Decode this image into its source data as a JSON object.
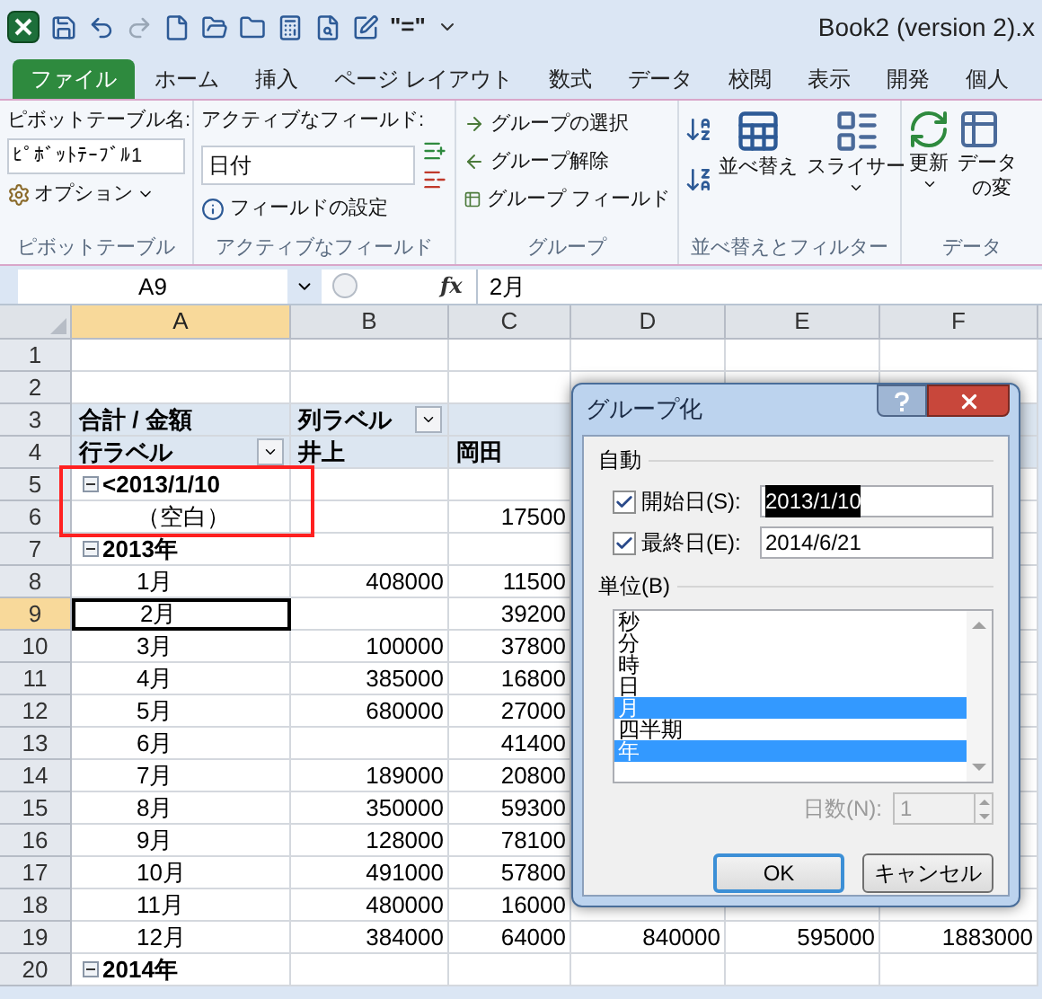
{
  "window": {
    "title": "Book2 (version 2).x",
    "quick_access_label": "\"=\""
  },
  "file_tab": "ファイル",
  "tabs": [
    {
      "label": "ホーム",
      "selected": false
    },
    {
      "label": "挿入",
      "selected": false
    },
    {
      "label": "ページ レイアウト",
      "selected": false
    },
    {
      "label": "数式",
      "selected": false
    },
    {
      "label": "データ",
      "selected": false
    },
    {
      "label": "校閲",
      "selected": false
    },
    {
      "label": "表示",
      "selected": false
    },
    {
      "label": "開発",
      "selected": false
    },
    {
      "label": "個人",
      "selected": false
    }
  ],
  "ribbon": {
    "pivot_group": {
      "title": "ピボットテーブル",
      "name_label": "ピボットテーブル名:",
      "name_value": "ﾋﾟﾎﾞｯﾄﾃｰﾌﾞﾙ1",
      "options": "オプション"
    },
    "field_group": {
      "title": "アクティブなフィールド",
      "label": "アクティブなフィールド:",
      "value": "日付",
      "settings": "フィールドの設定"
    },
    "group_group": {
      "title": "グループ",
      "items": [
        "グループの選択",
        "グループ解除",
        "グループ フィールド"
      ]
    },
    "sort_group": {
      "title": "並べ替えとフィルター",
      "sort": "並べ替え",
      "slicer": "スライサー"
    },
    "data_group": {
      "title": "データ",
      "refresh": "更新",
      "change": [
        "データ",
        "の変"
      ]
    }
  },
  "name_box": "A9",
  "function_label": "fx",
  "formula": "2月",
  "columns": [
    {
      "label": "A",
      "selected": true
    },
    {
      "label": "B",
      "selected": false
    },
    {
      "label": "C",
      "selected": false
    },
    {
      "label": "D",
      "selected": false
    },
    {
      "label": "E",
      "selected": false
    },
    {
      "label": "F",
      "selected": false
    }
  ],
  "rows": [
    {
      "number": "1",
      "kind": "plain",
      "selected": false,
      "boxed": false,
      "cells": {}
    },
    {
      "number": "2",
      "kind": "plain",
      "selected": false,
      "boxed": false,
      "cells": {}
    },
    {
      "number": "3",
      "kind": "pivot_header",
      "selected": false,
      "boxed": false,
      "cells": {
        "A": "合計 / 金額",
        "B": {
          "text": "列ラベル",
          "filter": true
        }
      }
    },
    {
      "number": "4",
      "kind": "pivot_header",
      "selected": false,
      "boxed": false,
      "cells": {
        "A": {
          "text": "行ラベル",
          "filter": true
        },
        "B": "井上",
        "C": "岡田"
      }
    },
    {
      "number": "5",
      "kind": "group",
      "expanded": true,
      "selected": false,
      "boxed": true,
      "cells": {
        "A": "<2013/1/10"
      }
    },
    {
      "number": "6",
      "kind": "item",
      "selected": false,
      "boxed": true,
      "cells": {
        "A": "（空白）",
        "C": "17500"
      }
    },
    {
      "number": "7",
      "kind": "group",
      "expanded": true,
      "selected": false,
      "boxed": false,
      "cells": {
        "A": "2013年"
      }
    },
    {
      "number": "8",
      "kind": "item",
      "selected": false,
      "boxed": false,
      "cells": {
        "A": "1月",
        "B": "408000",
        "C": "11500"
      }
    },
    {
      "number": "9",
      "kind": "item",
      "selected": true,
      "boxed": false,
      "cells": {
        "A": "2月",
        "C": "39200"
      }
    },
    {
      "number": "10",
      "kind": "item",
      "selected": false,
      "boxed": false,
      "cells": {
        "A": "3月",
        "B": "100000",
        "C": "37800"
      }
    },
    {
      "number": "11",
      "kind": "item",
      "selected": false,
      "boxed": false,
      "cells": {
        "A": "4月",
        "B": "385000",
        "C": "16800"
      }
    },
    {
      "number": "12",
      "kind": "item",
      "selected": false,
      "boxed": false,
      "cells": {
        "A": "5月",
        "B": "680000",
        "C": "27000"
      }
    },
    {
      "number": "13",
      "kind": "item",
      "selected": false,
      "boxed": false,
      "cells": {
        "A": "6月",
        "C": "41400"
      }
    },
    {
      "number": "14",
      "kind": "item",
      "selected": false,
      "boxed": false,
      "cells": {
        "A": "7月",
        "B": "189000",
        "C": "20800"
      }
    },
    {
      "number": "15",
      "kind": "item",
      "selected": false,
      "boxed": false,
      "cells": {
        "A": "8月",
        "B": "350000",
        "C": "59300"
      }
    },
    {
      "number": "16",
      "kind": "item",
      "selected": false,
      "boxed": false,
      "cells": {
        "A": "9月",
        "B": "128000",
        "C": "78100"
      }
    },
    {
      "number": "17",
      "kind": "item",
      "selected": false,
      "boxed": false,
      "cells": {
        "A": "10月",
        "B": "491000",
        "C": "57800"
      }
    },
    {
      "number": "18",
      "kind": "item",
      "selected": false,
      "boxed": false,
      "cells": {
        "A": "11月",
        "B": "480000",
        "C": "16000"
      }
    },
    {
      "number": "19",
      "kind": "item",
      "selected": false,
      "boxed": false,
      "cells": {
        "A": "12月",
        "B": "384000",
        "C": "64000",
        "D": "840000",
        "E": "595000",
        "F": "1883000"
      }
    },
    {
      "number": "20",
      "kind": "group",
      "expanded": true,
      "selected": false,
      "boxed": false,
      "cells": {
        "A": "2014年"
      }
    }
  ],
  "dialog": {
    "title": "グループ化",
    "auto_label": "自動",
    "dates": [
      {
        "label": "開始日(S):",
        "checked": true,
        "value": "2013/1/10",
        "selected": true
      },
      {
        "label": "最終日(E):",
        "checked": true,
        "value": "2014/6/21",
        "selected": false
      }
    ],
    "unit_label": "単位(B)",
    "units": [
      {
        "label": "秒",
        "selected": false
      },
      {
        "label": "分",
        "selected": false
      },
      {
        "label": "時",
        "selected": false
      },
      {
        "label": "日",
        "selected": false
      },
      {
        "label": "月",
        "selected": true
      },
      {
        "label": "四半期",
        "selected": false
      },
      {
        "label": "年",
        "selected": true
      }
    ],
    "days": {
      "label": "日数(N):",
      "value": "1",
      "disabled": true
    },
    "buttons": [
      {
        "label": "OK",
        "kind": "default"
      },
      {
        "label": "キャンセル",
        "kind": "normal"
      }
    ]
  }
}
